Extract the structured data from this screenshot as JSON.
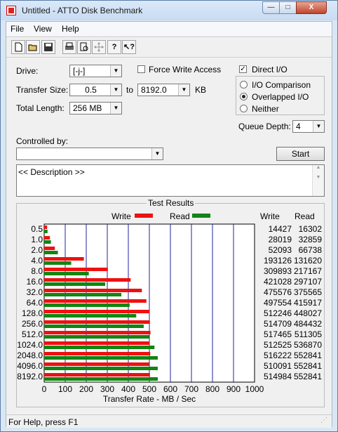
{
  "window": {
    "title": "Untitled - ATTO Disk Benchmark",
    "minimize": "—",
    "maximize": "□",
    "close": "X"
  },
  "menu": {
    "items": [
      "File",
      "View",
      "Help"
    ]
  },
  "toolbar": {
    "icons": [
      "new-file-icon",
      "open-folder-icon",
      "save-icon",
      "print-icon",
      "print-preview-icon",
      "move-icon",
      "help-icon",
      "context-help-icon"
    ]
  },
  "form": {
    "drive_label": "Drive:",
    "drive_value": "[-j-]",
    "force_write_label": "Force Write Access",
    "force_write_checked": false,
    "direct_io_label": "Direct I/O",
    "direct_io_checked": true,
    "transfer_size_label": "Transfer Size:",
    "transfer_from": "0.5",
    "to_label": "to",
    "transfer_to": "8192.0",
    "kb_label": "KB",
    "total_length_label": "Total Length:",
    "total_length_value": "256 MB",
    "io_options": [
      "I/O Comparison",
      "Overlapped I/O",
      "Neither"
    ],
    "io_selected": 1,
    "queue_depth_label": "Queue Depth:",
    "queue_depth_value": "4",
    "controlled_by_label": "Controlled by:",
    "controlled_by_value": "",
    "start_label": "Start",
    "description": "<< Description >>"
  },
  "results": {
    "title": "Test Results",
    "legend_write": "Write",
    "legend_read": "Read",
    "col_write": "Write",
    "col_read": "Read"
  },
  "colors": {
    "write": "#ee1111",
    "read": "#128512",
    "gridline": "#2020a0"
  },
  "chart_data": {
    "type": "bar",
    "orientation": "horizontal",
    "categories": [
      "0.5",
      "1.0",
      "2.0",
      "4.0",
      "8.0",
      "16.0",
      "32.0",
      "64.0",
      "128.0",
      "256.0",
      "512.0",
      "1024.0",
      "2048.0",
      "4096.0",
      "8192.0"
    ],
    "series": [
      {
        "name": "Write",
        "values": [
          14427,
          28019,
          52093,
          193126,
          309893,
          421028,
          475576,
          497554,
          512246,
          514709,
          517465,
          512525,
          516222,
          510091,
          514984
        ]
      },
      {
        "name": "Read",
        "values": [
          16302,
          32859,
          66738,
          131620,
          217167,
          297107,
          375565,
          415917,
          448027,
          484432,
          511305,
          536870,
          552841,
          552841,
          552841
        ]
      }
    ],
    "xticks": [
      "0",
      "100",
      "200",
      "300",
      "400",
      "500",
      "600",
      "700",
      "800",
      "900",
      "1000"
    ],
    "xlim": [
      0,
      1000
    ],
    "xlabel": "Transfer Rate - MB / Sec",
    "grid": true
  },
  "status": {
    "text": "For Help, press F1"
  }
}
